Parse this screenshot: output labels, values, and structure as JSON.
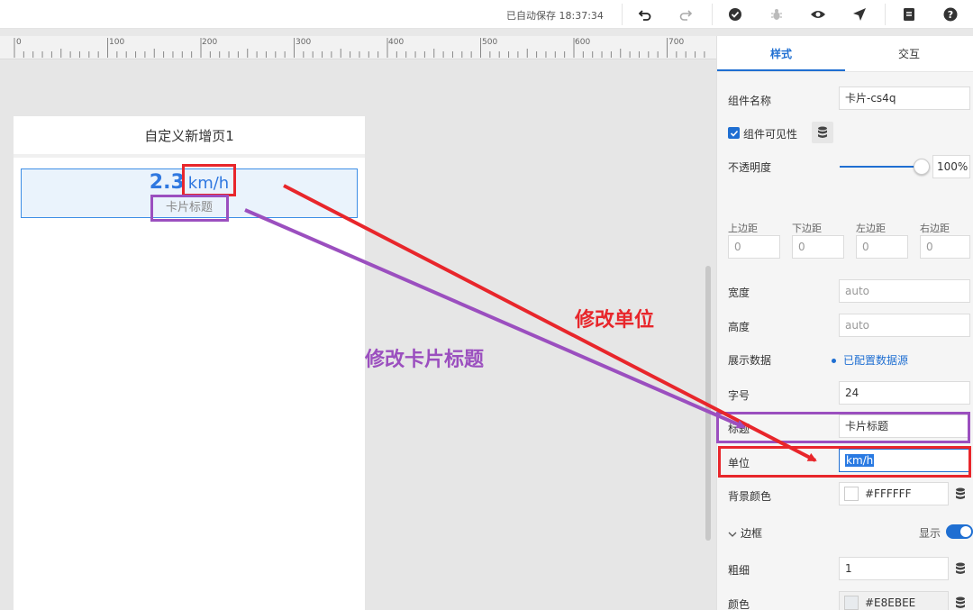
{
  "toolbar": {
    "autosave_text": "已自动保存 18:37:34"
  },
  "ruler": {
    "labels": [
      "0",
      "100",
      "200",
      "300",
      "400",
      "500",
      "600",
      "700"
    ]
  },
  "page": {
    "title": "自定义新增页1",
    "card": {
      "value": "2.3",
      "unit": "km/h",
      "title": "卡片标题"
    }
  },
  "annotations": {
    "unit_label": "修改单位",
    "title_label": "修改卡片标题",
    "unit_color": "#e8262b",
    "title_color": "#9b4fbf"
  },
  "panel": {
    "tabs": [
      "样式",
      "交互"
    ],
    "component_name_label": "组件名称",
    "component_name_value": "卡片-cs4q",
    "visibility_label": "组件可见性",
    "opacity_label": "不透明度",
    "opacity_value": "100%",
    "opacity_level": 1.0,
    "margin_labels": [
      "上边距",
      "下边距",
      "左边距",
      "右边距"
    ],
    "margin_values": [
      "0",
      "0",
      "0",
      "0"
    ],
    "width_label": "宽度",
    "width_value": "auto",
    "height_label": "高度",
    "height_value": "auto",
    "data_label": "展示数据",
    "data_value": "已配置数据源",
    "font_size_label": "字号",
    "font_size_value": "24",
    "title_label": "标题",
    "title_value": "卡片标题",
    "unit_label": "单位",
    "unit_value": "km/h",
    "bg_color_label": "背景颜色",
    "bg_color_value": "#FFFFFF",
    "border_section": "边框",
    "border_show_label": "显示",
    "border_width_label": "粗细",
    "border_width_value": "1",
    "border_color_label": "颜色",
    "border_color_value": "#E8EBEE"
  }
}
